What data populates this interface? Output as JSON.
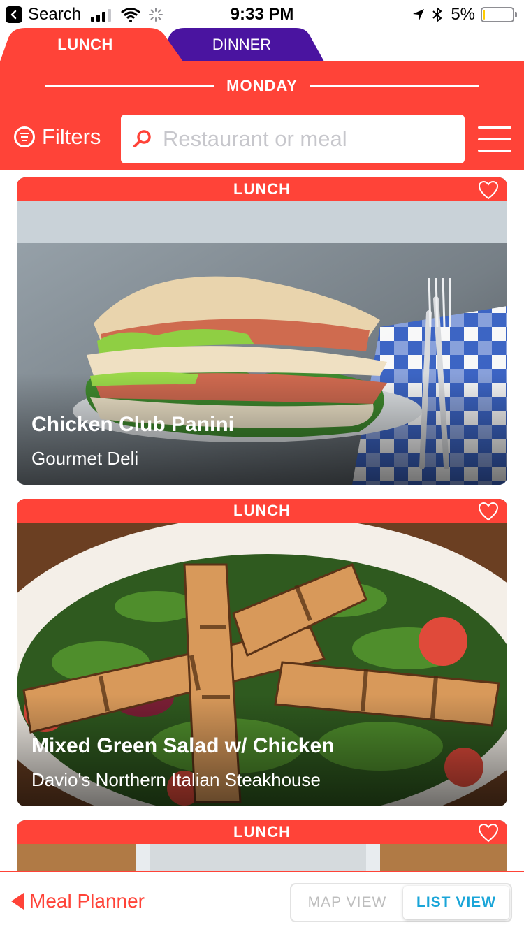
{
  "status_bar": {
    "back_label": "Search",
    "time": "9:33 PM",
    "battery": "5%",
    "battery_level": 0.05
  },
  "tabs": [
    {
      "label": "LUNCH",
      "active": true,
      "color": "#ff4338"
    },
    {
      "label": "DINNER",
      "active": false,
      "color": "#4a14a0"
    }
  ],
  "header": {
    "day": "MONDAY",
    "filters_label": "Filters",
    "search_placeholder": "Restaurant or meal",
    "accent": "#ff4338"
  },
  "cards": [
    {
      "band": "LUNCH",
      "title": "Chicken Club Panini",
      "restaurant": "Gourmet Deli"
    },
    {
      "band": "LUNCH",
      "title": "Mixed Green Salad w/ Chicken",
      "restaurant": "Davio's Northern Italian Steakhouse"
    },
    {
      "band": "LUNCH",
      "title": "",
      "restaurant": ""
    }
  ],
  "bottom": {
    "planner_label": "Meal Planner",
    "map_view": "MAP VIEW",
    "list_view": "LIST VIEW",
    "list_color": "#1aa5d8"
  }
}
